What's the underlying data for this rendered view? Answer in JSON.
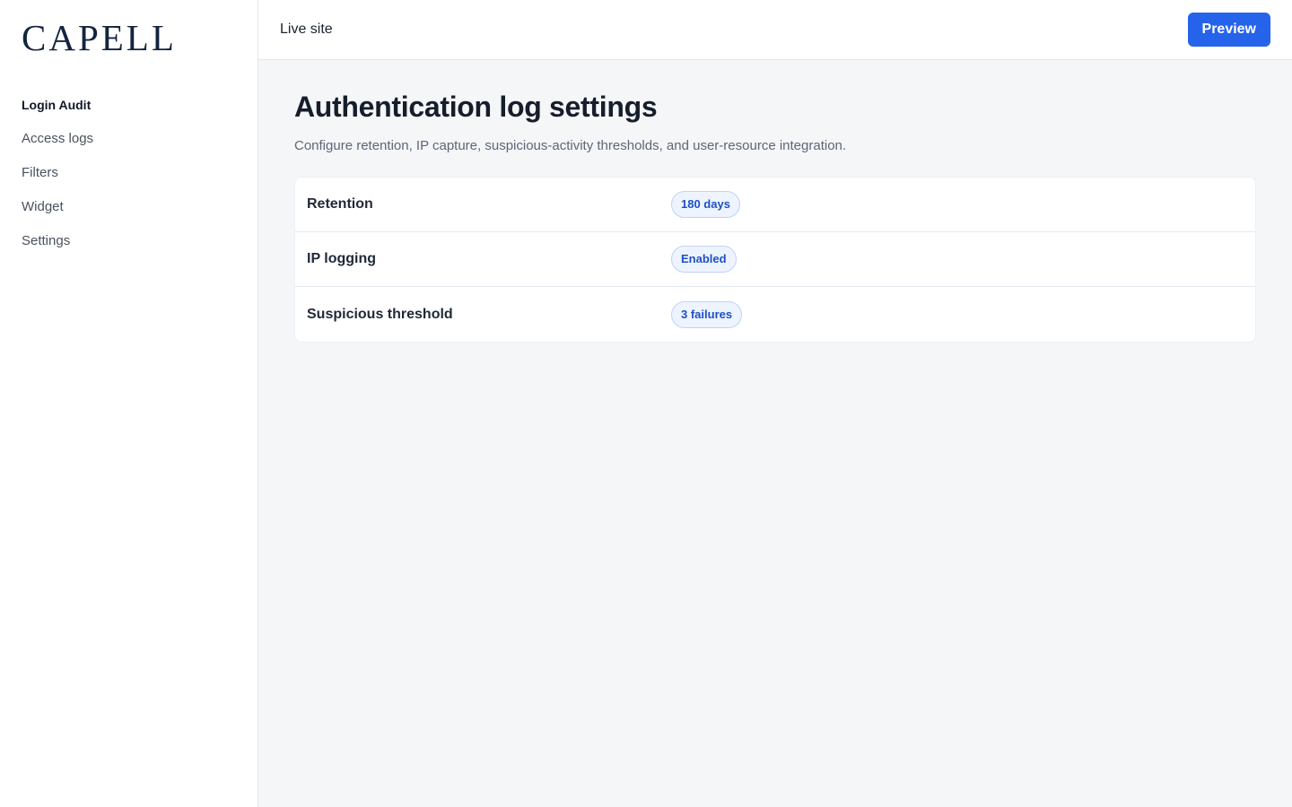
{
  "brand": {
    "logo_text": "CAPELL"
  },
  "sidebar": {
    "items": [
      {
        "label": "Login Audit",
        "active": true
      },
      {
        "label": "Access logs",
        "active": false
      },
      {
        "label": "Filters",
        "active": false
      },
      {
        "label": "Widget",
        "active": false
      },
      {
        "label": "Settings",
        "active": false
      }
    ]
  },
  "topbar": {
    "title": "Live site",
    "preview_label": "Preview"
  },
  "main": {
    "title": "Authentication log settings",
    "subtitle": "Configure retention, IP capture, suspicious-activity thresholds, and user-resource integration.",
    "settings": [
      {
        "label": "Retention",
        "value": "180 days"
      },
      {
        "label": "IP logging",
        "value": "Enabled"
      },
      {
        "label": "Suspicious threshold",
        "value": "3 failures"
      }
    ]
  },
  "colors": {
    "accent": "#2563eb",
    "badge_bg": "#eef4ff",
    "badge_text": "#1e4fc4",
    "logo": "#13243f"
  }
}
